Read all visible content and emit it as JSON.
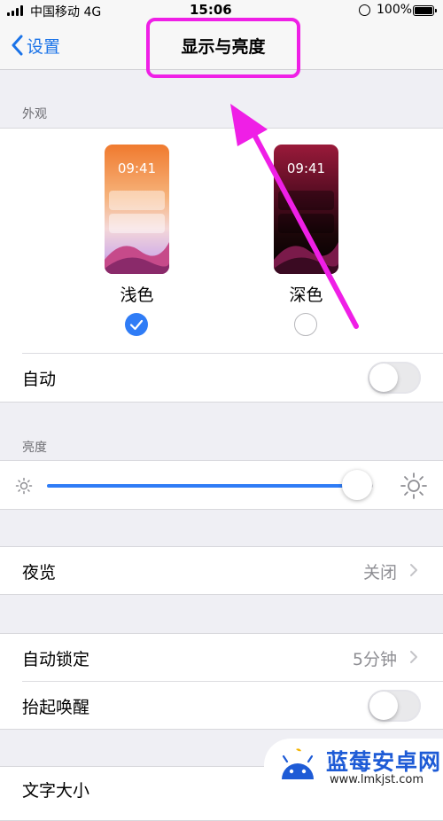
{
  "status_bar": {
    "carrier": "中国移动  4G",
    "time": "15:06",
    "battery": "100%"
  },
  "nav": {
    "back_label": "设置",
    "title": "显示与亮度"
  },
  "appearance": {
    "section_label": "外观",
    "light": {
      "name": "浅色",
      "time": "09:41",
      "selected": true
    },
    "dark": {
      "name": "深色",
      "time": "09:41",
      "selected": false
    },
    "auto_label": "自动",
    "auto_on": false
  },
  "brightness": {
    "section_label": "亮度",
    "level": 0.95
  },
  "night_shift": {
    "label": "夜览",
    "value": "关闭"
  },
  "auto_lock": {
    "label": "自动锁定",
    "value": "5分钟"
  },
  "raise_to_wake": {
    "label": "抬起唤醒",
    "on": false
  },
  "text_size": {
    "label": "文字大小"
  },
  "colors": {
    "accent": "#1a73e8",
    "highlight": "#ef1fe6"
  },
  "watermark": {
    "title": "蓝莓安卓网",
    "url": "www.lmkjst.com"
  }
}
